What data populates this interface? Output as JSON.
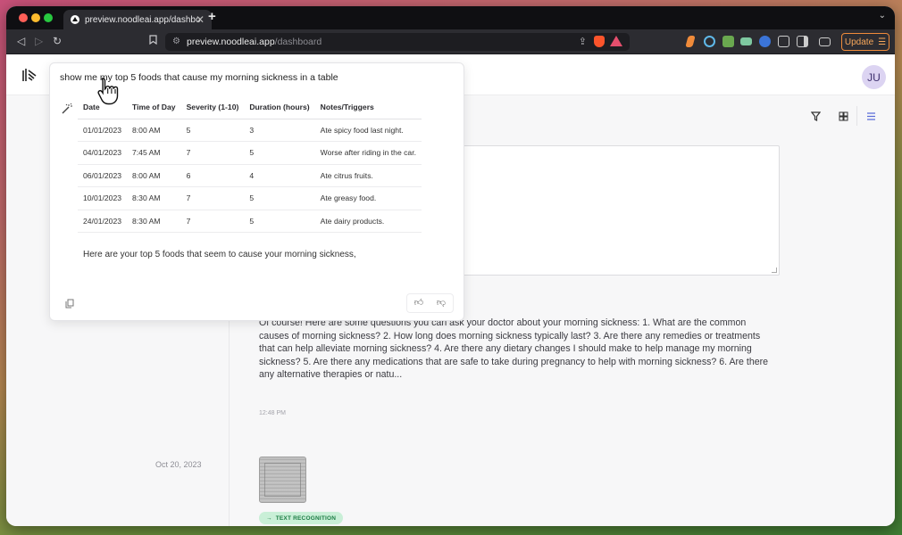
{
  "browser": {
    "tab_title": "preview.noodleai.app/dashboa",
    "url_host": "preview.noodleai.app",
    "url_path": "/dashboard",
    "update_label": "Update",
    "tab_close": "✕",
    "new_tab": "+",
    "tab_list": "⌄"
  },
  "user": {
    "initials": "JU"
  },
  "popup": {
    "query": "show me my top 5 foods that cause my morning sickness in a table",
    "columns": [
      "Date",
      "Time of Day",
      "Severity (1-10)",
      "Duration (hours)",
      "Notes/Triggers"
    ],
    "rows": [
      [
        "01/01/2023",
        "8:00 AM",
        "5",
        "3",
        "Ate spicy food last night."
      ],
      [
        "04/01/2023",
        "7:45 AM",
        "7",
        "5",
        "Worse after riding in the car."
      ],
      [
        "06/01/2023",
        "8:00 AM",
        "6",
        "4",
        "Ate citrus fruits."
      ],
      [
        "10/01/2023",
        "8:30 AM",
        "7",
        "5",
        "Ate greasy food."
      ],
      [
        "24/01/2023",
        "8:30 AM",
        "7",
        "5",
        "Ate dairy products."
      ]
    ],
    "summary": "Here are your top 5 foods that seem to cause your morning sickness,"
  },
  "feed": {
    "answer_text": "Of course! Here are some questions you can ask your doctor about your morning sickness: 1. What are the common causes of morning sickness? 2. How long does morning sickness typically last? 3. Are there any remedies or treatments that can help alleviate morning sickness? 4. Are there any dietary changes I should make to help manage my morning sickness? 5. Are there any medications that are safe to take during pregnancy to help with morning sickness? 6. Are there any alternative therapies or natu...",
    "time": "12:48 PM",
    "date2": "Oct 20, 2023",
    "badge_label": "TEXT RECOGNITION"
  },
  "colors": {
    "accent_green": "#1d7d45",
    "badge_bg": "#c9efd7",
    "avatar_bg": "#dcd4f2",
    "update_orange": "#f08b3a"
  }
}
